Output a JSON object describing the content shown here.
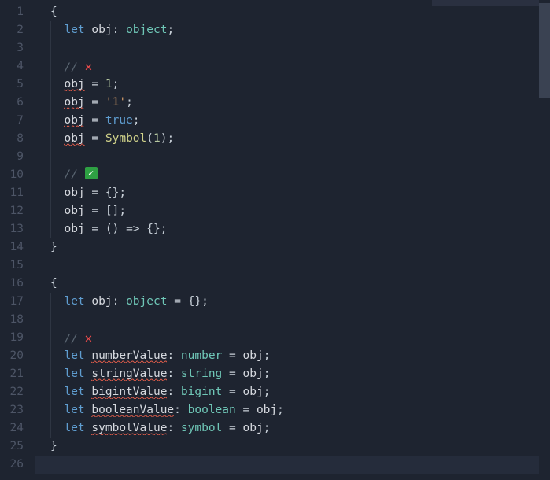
{
  "gutter": [
    "1",
    "2",
    "3",
    "4",
    "5",
    "6",
    "7",
    "8",
    "9",
    "10",
    "11",
    "12",
    "13",
    "14",
    "15",
    "16",
    "17",
    "18",
    "19",
    "20",
    "21",
    "22",
    "23",
    "24",
    "25",
    "26"
  ],
  "tok": {
    "let": "let",
    "obj": "obj",
    "object": "object",
    "true": "true",
    "Symbol": "Symbol",
    "number": "number",
    "string": "string",
    "bigint": "bigint",
    "boolean": "boolean",
    "symbol": "symbol",
    "numberValue": "numberValue",
    "stringValue": "stringValue",
    "bigintValue": "bigintValue",
    "booleanValue": "booleanValue",
    "symbolValue": "symbolValue",
    "one": "1",
    "str1": "'1'",
    "braces": "{}",
    "brackets": "[]",
    "arrowempty": "() => {}",
    "slashslash": "// ",
    "eq": " = ",
    "colon": ": ",
    "semi": ";",
    "lbrace": "{",
    "rbrace": "}"
  },
  "icons": {
    "x": "✕",
    "check": "✓"
  }
}
